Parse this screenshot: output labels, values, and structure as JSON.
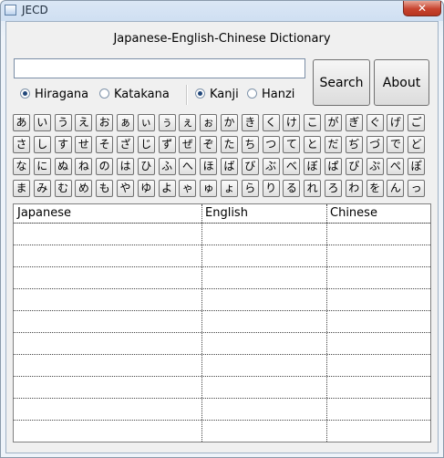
{
  "window": {
    "title": "JECD",
    "close_glyph": "✕"
  },
  "heading": "Japanese-English-Chinese Dictionary",
  "search": {
    "value": "",
    "placeholder": ""
  },
  "buttons": {
    "search": "Search",
    "about": "About"
  },
  "script_options": [
    {
      "label": "Hiragana",
      "selected": true
    },
    {
      "label": "Katakana",
      "selected": false
    }
  ],
  "char_options": [
    {
      "label": "Kanji",
      "selected": true
    },
    {
      "label": "Hanzi",
      "selected": false
    }
  ],
  "kana_rows": [
    [
      "あ",
      "い",
      "う",
      "え",
      "お",
      "ぁ",
      "ぃ",
      "ぅ",
      "ぇ",
      "ぉ",
      "か",
      "き",
      "く",
      "け",
      "こ",
      "が",
      "ぎ",
      "ぐ",
      "げ",
      "ご"
    ],
    [
      "さ",
      "し",
      "す",
      "せ",
      "そ",
      "ざ",
      "じ",
      "ず",
      "ぜ",
      "ぞ",
      "た",
      "ち",
      "つ",
      "て",
      "と",
      "だ",
      "ぢ",
      "づ",
      "で",
      "ど"
    ],
    [
      "な",
      "に",
      "ぬ",
      "ね",
      "の",
      "は",
      "ひ",
      "ふ",
      "へ",
      "ほ",
      "ば",
      "び",
      "ぶ",
      "べ",
      "ぼ",
      "ぱ",
      "ぴ",
      "ぷ",
      "ぺ",
      "ぽ"
    ],
    [
      "ま",
      "み",
      "む",
      "め",
      "も",
      "や",
      "ゆ",
      "よ",
      "ゃ",
      "ゅ",
      "ょ",
      "ら",
      "り",
      "る",
      "れ",
      "ろ",
      "わ",
      "を",
      "ん",
      "っ"
    ]
  ],
  "results_table": {
    "columns": [
      "Japanese",
      "English",
      "Chinese"
    ],
    "rows": []
  }
}
